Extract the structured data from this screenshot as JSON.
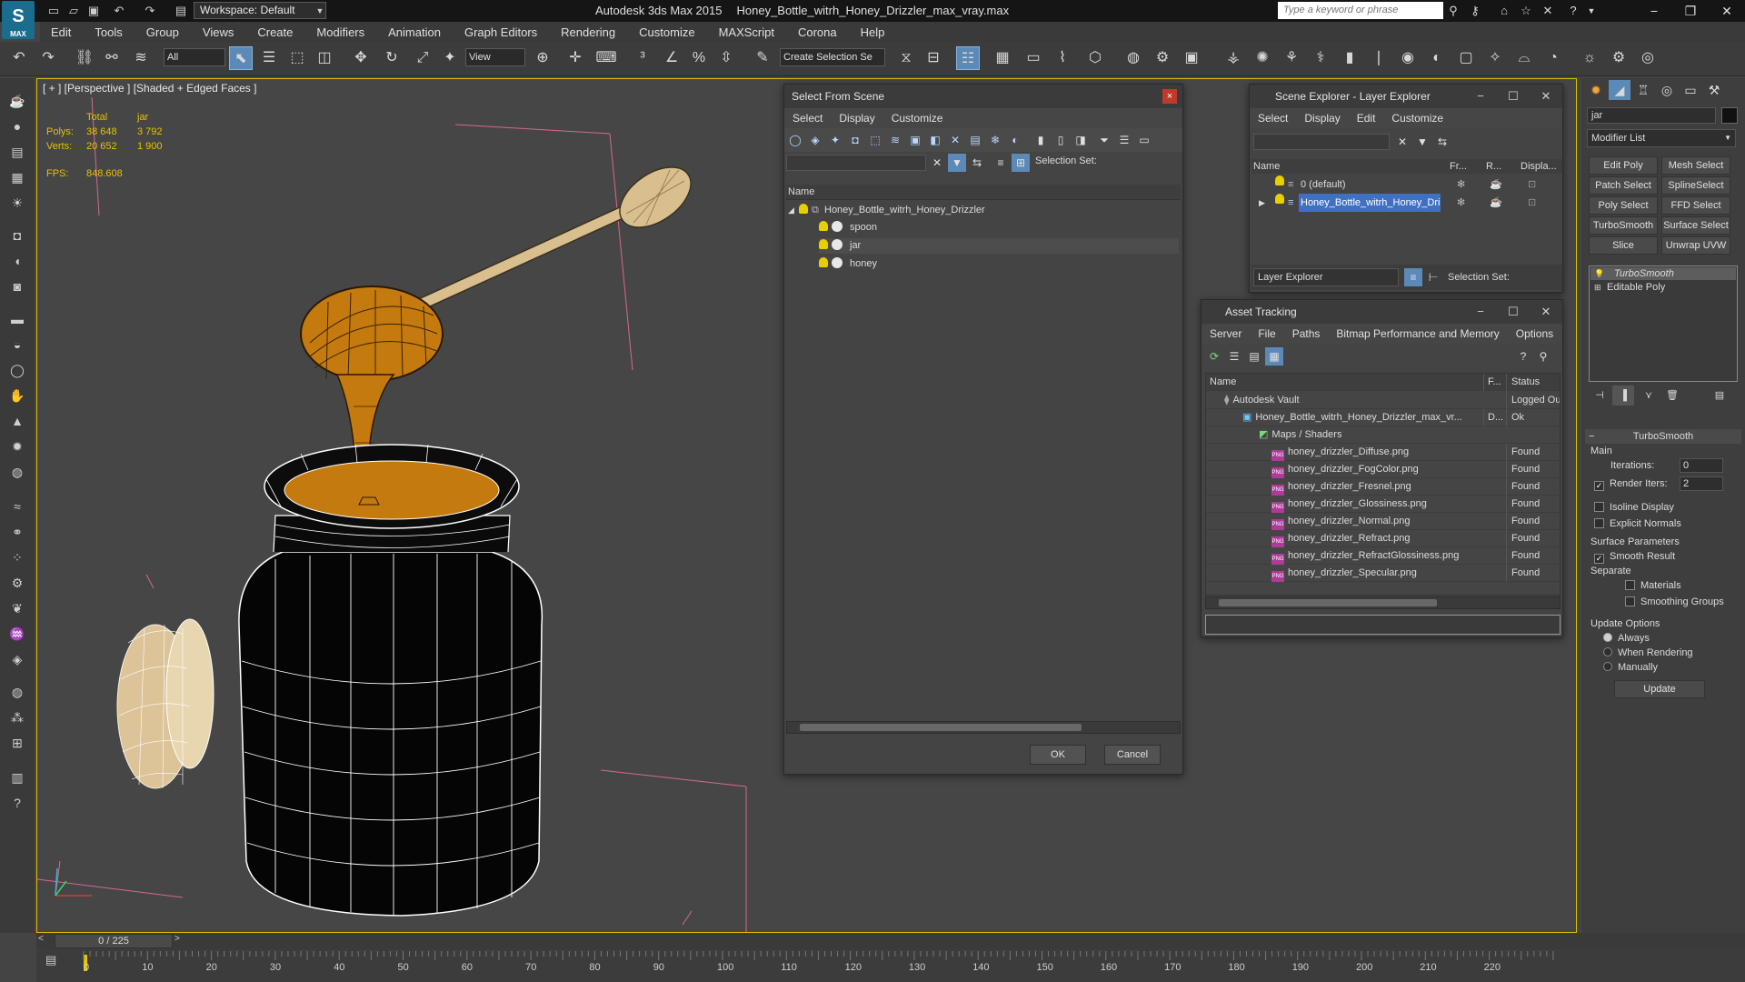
{
  "app": {
    "logo": "MAX",
    "workspace": "Workspace: Default",
    "product": "Autodesk 3ds Max  2015",
    "file": "Honey_Bottle_witrh_Honey_Drizzler_max_vray.max",
    "search_placeholder": "Type a keyword or phrase"
  },
  "menu": [
    "Edit",
    "Tools",
    "Group",
    "Views",
    "Create",
    "Modifiers",
    "Animation",
    "Graph Editors",
    "Rendering",
    "Customize",
    "MAXScript",
    "Corona",
    "Help"
  ],
  "toolbar": {
    "filter": "All",
    "ref_coord": "View",
    "selection_set": "Create Selection Se"
  },
  "viewport": {
    "label": "[ + ] [Perspective ] [Shaded + Edged Faces ]",
    "stats": {
      "col_total": "Total",
      "col_object": "jar",
      "polys_label": "Polys:",
      "polys_total": "38 648",
      "polys_object": "3 792",
      "verts_label": "Verts:",
      "verts_total": "20 652",
      "verts_object": "1 900",
      "fps_label": "FPS:",
      "fps_value": "848.608"
    }
  },
  "select_from_scene": {
    "title": "Select From Scene",
    "menu": [
      "Select",
      "Display",
      "Customize"
    ],
    "selection_set_label": "Selection Set:",
    "col_name": "Name",
    "root": "Honey_Bottle_witrh_Honey_Drizzler",
    "children": [
      "spoon",
      "jar",
      "honey"
    ],
    "ok": "OK",
    "cancel": "Cancel"
  },
  "scene_explorer": {
    "title": "Scene Explorer - Layer Explorer",
    "menu": [
      "Select",
      "Display",
      "Edit",
      "Customize"
    ],
    "col_name": "Name",
    "col_fr": "Fr...",
    "col_r": "R...",
    "col_display": "Displa...",
    "layers": [
      "0 (default)",
      "Honey_Bottle_witrh_Honey_Dri..."
    ],
    "footer_dropdown": "Layer Explorer",
    "selection_set_label": "Selection Set:"
  },
  "asset_tracking": {
    "title": "Asset Tracking",
    "menu": [
      "Server",
      "File",
      "Paths",
      "Bitmap Performance and Memory",
      "Options"
    ],
    "col_name": "Name",
    "col_f": "F...",
    "col_status": "Status",
    "rows": [
      {
        "name": "Autodesk Vault",
        "f": "",
        "status": "Logged Ou"
      },
      {
        "name": "Honey_Bottle_witrh_Honey_Drizzler_max_vr...",
        "f": "D...",
        "status": "Ok"
      },
      {
        "name": "Maps / Shaders",
        "f": "",
        "status": ""
      },
      {
        "name": "honey_drizzler_Diffuse.png",
        "f": "",
        "status": "Found"
      },
      {
        "name": "honey_drizzler_FogColor.png",
        "f": "",
        "status": "Found"
      },
      {
        "name": "honey_drizzler_Fresnel.png",
        "f": "",
        "status": "Found"
      },
      {
        "name": "honey_drizzler_Glossiness.png",
        "f": "",
        "status": "Found"
      },
      {
        "name": "honey_drizzler_Normal.png",
        "f": "",
        "status": "Found"
      },
      {
        "name": "honey_drizzler_Refract.png",
        "f": "",
        "status": "Found"
      },
      {
        "name": "honey_drizzler_RefractGlossiness.png",
        "f": "",
        "status": "Found"
      },
      {
        "name": "honey_drizzler_Specular.png",
        "f": "",
        "status": "Found"
      }
    ],
    "png_badge": "PNG"
  },
  "command_panel": {
    "object_name": "jar",
    "modifier_list": "Modifier List",
    "buttons": [
      "Edit Poly",
      "Mesh Select",
      "Patch Select",
      "SplineSelect",
      "Poly Select",
      "FFD Select",
      "TurboSmooth",
      "Surface Select",
      "Slice",
      "Unwrap UVW"
    ],
    "stack": [
      "TurboSmooth",
      "Editable Poly"
    ],
    "rollout_title": "TurboSmooth",
    "main_label": "Main",
    "iterations_label": "Iterations:",
    "iterations_value": "0",
    "render_iters_label": "Render Iters:",
    "render_iters_value": "2",
    "isoline": "Isoline Display",
    "explicit_normals": "Explicit Normals",
    "surface_params": "Surface Parameters",
    "smooth_result": "Smooth Result",
    "separate": "Separate",
    "materials": "Materials",
    "smoothing_groups": "Smoothing Groups",
    "update_options": "Update Options",
    "always": "Always",
    "when_rendering": "When Rendering",
    "manually": "Manually",
    "update": "Update"
  },
  "timeline": {
    "frame": "0 / 225",
    "ticks": [
      "0",
      "10",
      "20",
      "30",
      "40",
      "50",
      "60",
      "70",
      "80",
      "90",
      "100",
      "110",
      "120",
      "130",
      "140",
      "150",
      "160",
      "170",
      "180",
      "190",
      "200",
      "210",
      "220"
    ]
  }
}
